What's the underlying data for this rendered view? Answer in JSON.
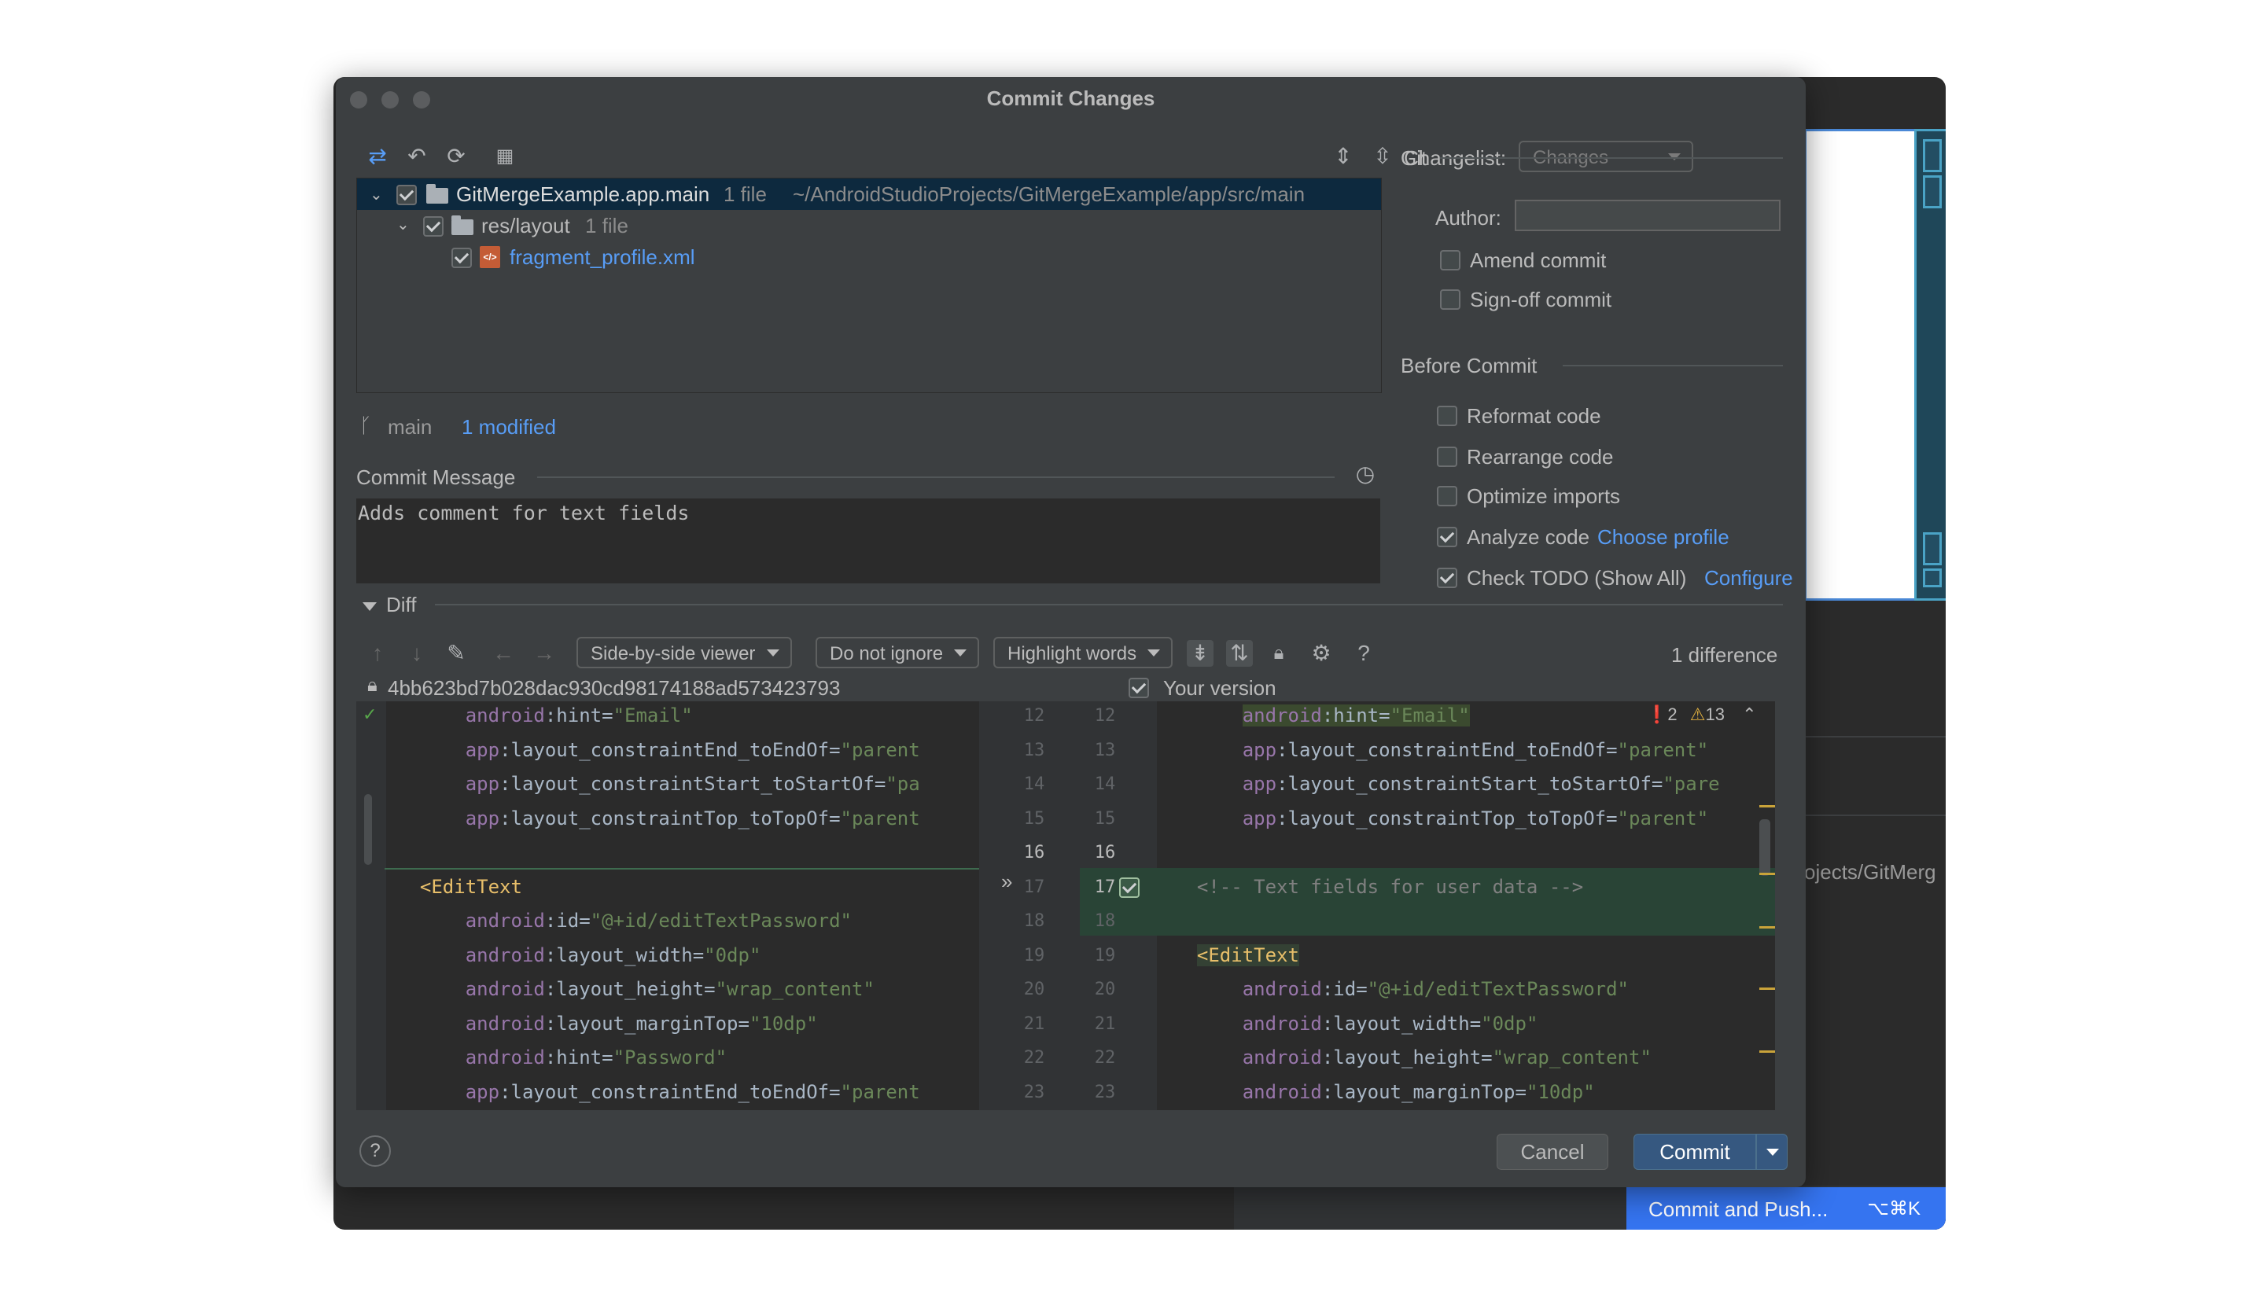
{
  "dialog": {
    "title": "Commit Changes",
    "help_icon": "question-icon"
  },
  "toolbar": {
    "changelist_label": "Changelist:",
    "changelist_value": "Changes"
  },
  "tree": {
    "root": {
      "name": "GitMergeExample.app.main",
      "count": "1 file",
      "path": "~/AndroidStudioProjects/GitMergeExample/app/src/main"
    },
    "folder": {
      "name": "res/layout",
      "count": "1 file"
    },
    "file": {
      "name": "fragment_profile.xml",
      "icon_text": "</>"
    }
  },
  "status": {
    "branch": "main",
    "modified": "1 modified"
  },
  "commit_message": {
    "label": "Commit Message",
    "text": "Adds comment for text fields"
  },
  "git": {
    "section_label": "Git",
    "author_label": "Author:",
    "author_value": "",
    "amend": "Amend commit",
    "signoff": "Sign-off commit"
  },
  "before_commit": {
    "section_label": "Before Commit",
    "reformat": "Reformat code",
    "rearrange": "Rearrange code",
    "optimize": "Optimize imports",
    "analyze": "Analyze code",
    "analyze_link": "Choose profile",
    "todo": "Check TODO (Show All)",
    "todo_link": "Configure"
  },
  "diff": {
    "label": "Diff",
    "viewer": "Side-by-side viewer",
    "ignore": "Do not ignore",
    "highlight": "Highlight words",
    "count": "1 difference",
    "left_hash": "4bb623bd7b028dac930cd98174188ad573423793",
    "right_label": "Your version",
    "errors": "2",
    "warnings": "13",
    "left_lines": [
      {
        "n": "12",
        "i": "      ",
        "a": "android",
        "k": ":hint=",
        "v": "\"Email\""
      },
      {
        "n": "13",
        "i": "      ",
        "a": "app",
        "k": ":layout_constraintEnd_toEndOf=",
        "v": "\"parent"
      },
      {
        "n": "14",
        "i": "      ",
        "a": "app",
        "k": ":layout_constraintStart_toStartOf=",
        "v": "\"pa"
      },
      {
        "n": "15",
        "i": "      ",
        "a": "app",
        "k": ":layout_constraintTop_toTopOf=",
        "v": "\"parent"
      },
      {
        "n": "16",
        "i": "",
        "a": "",
        "k": "",
        "v": ""
      },
      {
        "n": "17",
        "i": "  ",
        "a": "",
        "k": "",
        "v": "",
        "t": "<EditText"
      },
      {
        "n": "18",
        "i": "      ",
        "a": "android",
        "k": ":id=",
        "v": "\"@+id/editTextPassword\""
      },
      {
        "n": "19",
        "i": "      ",
        "a": "android",
        "k": ":layout_width=",
        "v": "\"0dp\""
      },
      {
        "n": "20",
        "i": "      ",
        "a": "android",
        "k": ":layout_height=",
        "v": "\"wrap_content\""
      },
      {
        "n": "21",
        "i": "      ",
        "a": "android",
        "k": ":layout_marginTop=",
        "v": "\"10dp\""
      },
      {
        "n": "22",
        "i": "      ",
        "a": "android",
        "k": ":hint=",
        "v": "\"Password\""
      },
      {
        "n": "23",
        "i": "      ",
        "a": "app",
        "k": ":layout_constraintEnd_toEndOf=",
        "v": "\"parent"
      }
    ],
    "right_lines": [
      {
        "n": "12",
        "i": "      ",
        "a": "android",
        "k": ":hint=",
        "v": "\"Email\""
      },
      {
        "n": "13",
        "i": "      ",
        "a": "app",
        "k": ":layout_constraintEnd_toEndOf=",
        "v": "\"parent\""
      },
      {
        "n": "14",
        "i": "      ",
        "a": "app",
        "k": ":layout_constraintStart_toStartOf=",
        "v": "\"pare"
      },
      {
        "n": "15",
        "i": "      ",
        "a": "app",
        "k": ":layout_constraintTop_toTopOf=",
        "v": "\"parent\""
      },
      {
        "n": "16",
        "i": "",
        "a": "",
        "k": "",
        "v": ""
      },
      {
        "n": "17",
        "i": "  ",
        "a": "",
        "k": "",
        "v": "",
        "c": "<!-- Text fields for user data -->"
      },
      {
        "n": "18",
        "i": "",
        "a": "",
        "k": "",
        "v": ""
      },
      {
        "n": "19",
        "i": "  ",
        "a": "",
        "k": "",
        "v": "",
        "t": "<EditText"
      },
      {
        "n": "20",
        "i": "      ",
        "a": "android",
        "k": ":id=",
        "v": "\"@+id/editTextPassword\""
      },
      {
        "n": "21",
        "i": "      ",
        "a": "android",
        "k": ":layout_width=",
        "v": "\"0dp\""
      },
      {
        "n": "22",
        "i": "      ",
        "a": "android",
        "k": ":layout_height=",
        "v": "\"wrap_content\""
      },
      {
        "n": "23",
        "i": "      ",
        "a": "android",
        "k": ":layout_marginTop=",
        "v": "\"10dp\""
      }
    ]
  },
  "buttons": {
    "cancel": "Cancel",
    "commit": "Commit",
    "commit_push": "Commit and Push...",
    "commit_push_shortcut": "⌥⌘K"
  },
  "background": {
    "path_fragment": "ojects/GitMerg"
  },
  "colors": {
    "accent": "#3574f0",
    "link": "#589df6",
    "inserted": "#294436",
    "dialog_bg": "#3c3f41",
    "editor_bg": "#2b2b2b"
  }
}
